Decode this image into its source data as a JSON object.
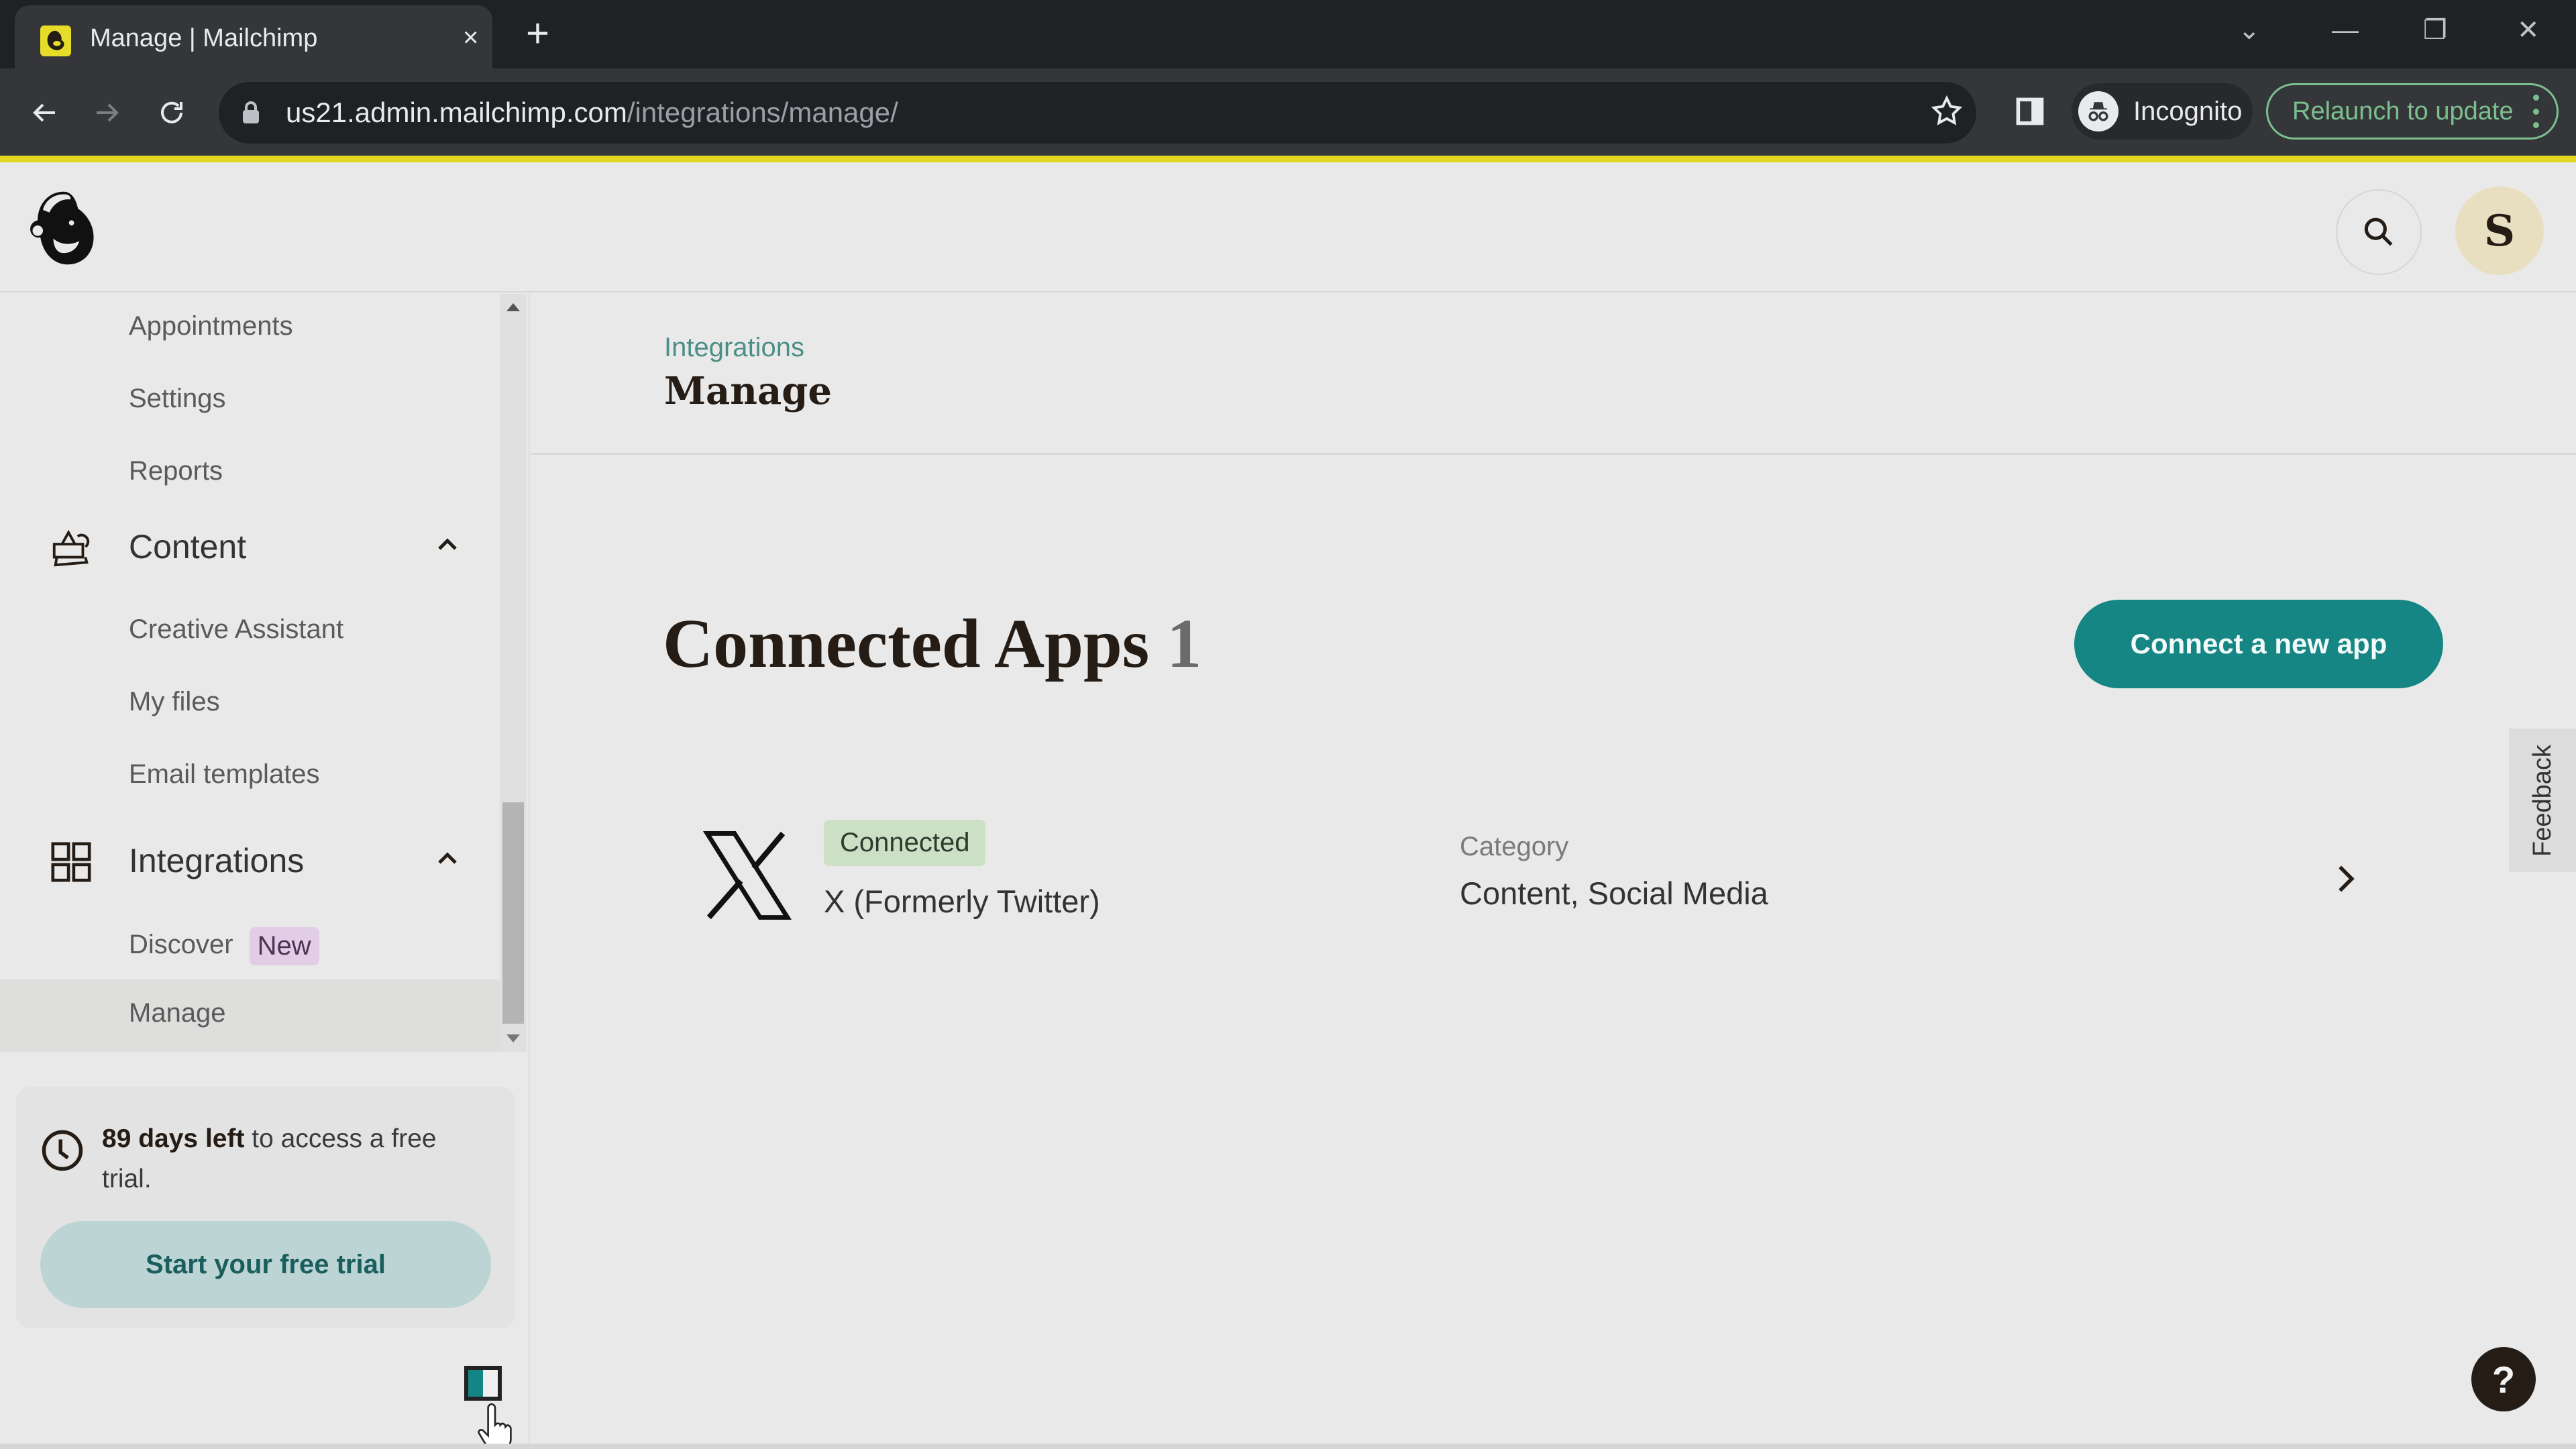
{
  "browser": {
    "tab_title": "Manage | Mailchimp",
    "tab_close": "×",
    "new_tab": "+",
    "url_host": "us21.admin.mailchimp.com",
    "url_path": "/integrations/manage/",
    "incognito_label": "Incognito",
    "relaunch_label": "Relaunch to update",
    "window_controls": {
      "tab_search": "⌄",
      "minimize": "—",
      "restore": "❐",
      "close": "✕"
    },
    "accent_color": "#e2d61e"
  },
  "header": {
    "logo": "mailchimp-freddie-logo",
    "avatar_initial": "S"
  },
  "sidebar": {
    "items_above": [
      {
        "label": "Appointments"
      },
      {
        "label": "Settings"
      },
      {
        "label": "Reports"
      }
    ],
    "groups": [
      {
        "label": "Content",
        "icon": "content-icon",
        "expanded": true,
        "items": [
          {
            "label": "Creative Assistant"
          },
          {
            "label": "My files"
          },
          {
            "label": "Email templates"
          }
        ]
      },
      {
        "label": "Integrations",
        "icon": "grid-icon",
        "expanded": true,
        "items": [
          {
            "label": "Discover",
            "badge": "New"
          },
          {
            "label": "Manage",
            "active": true
          }
        ]
      }
    ],
    "trial": {
      "days_bold": "89 days left",
      "rest": " to access a free trial.",
      "button_label": "Start your free trial"
    }
  },
  "main": {
    "breadcrumb": "Integrations",
    "page_title": "Manage",
    "section_title": "Connected Apps",
    "section_count": "1",
    "connect_button": "Connect a new app",
    "connect_button_color": "#158683",
    "apps": [
      {
        "name": "X (Formerly Twitter)",
        "status": "Connected",
        "category_label": "Category",
        "category_value": "Content, Social Media"
      }
    ],
    "feedback_label": "Feedback",
    "help_label": "?"
  }
}
